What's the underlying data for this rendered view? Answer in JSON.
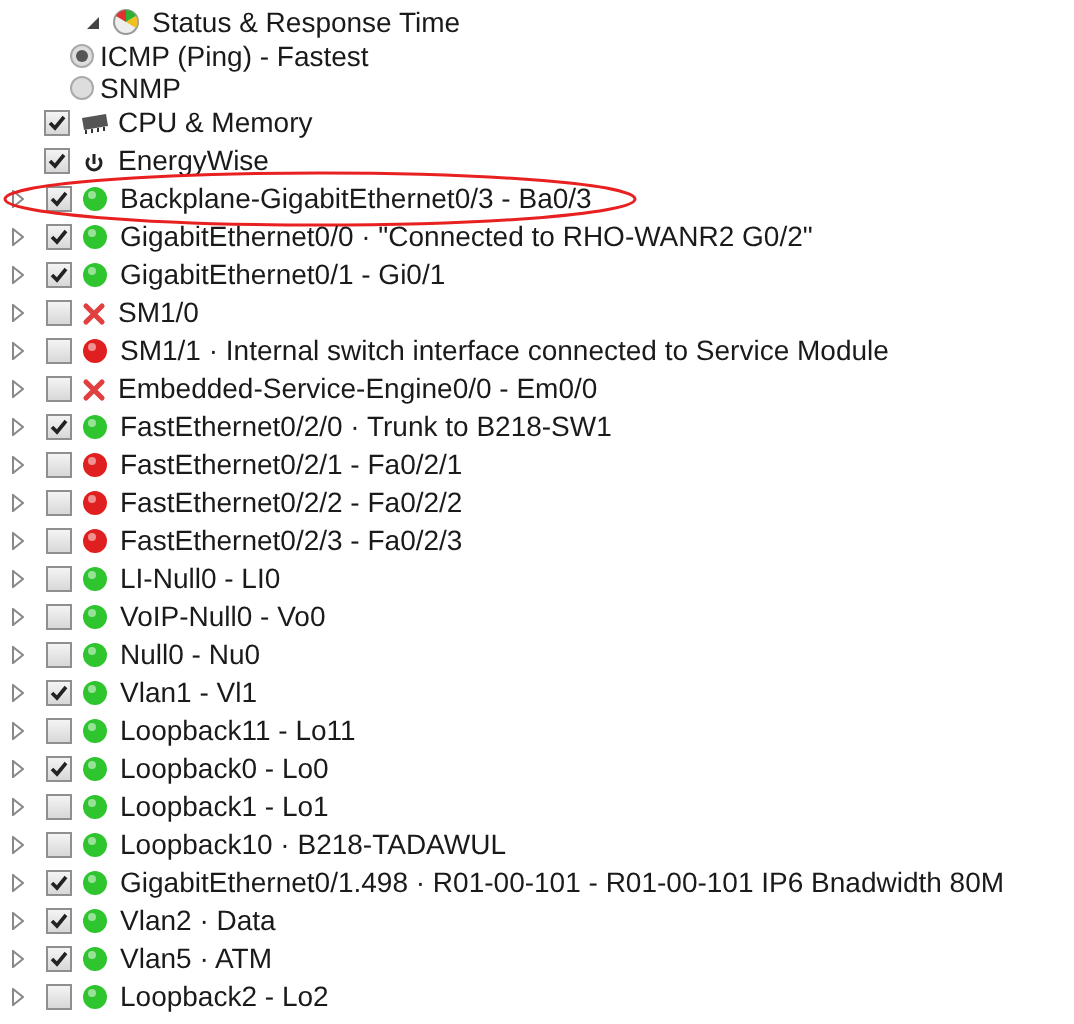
{
  "poller": {
    "label": "Status & Response Time",
    "expanded": true,
    "options": [
      {
        "label": "ICMP (Ping) - Fastest",
        "selected": true
      },
      {
        "label": "SNMP",
        "selected": false
      }
    ]
  },
  "resources": [
    {
      "kind": "chip",
      "label": "CPU & Memory",
      "checked": true
    },
    {
      "kind": "power",
      "label": "EnergyWise",
      "checked": true
    }
  ],
  "interfaces": [
    {
      "label": "Backplane-GigabitEthernet0/3 - Ba0/3",
      "checked": true,
      "kind": "dot",
      "color": "#2fc52f",
      "circled": true
    },
    {
      "label": "GigabitEthernet0/0 · \"Connected to RHO-WANR2 G0/2\"",
      "checked": true,
      "kind": "dot",
      "color": "#2fc52f",
      "circled": false
    },
    {
      "label": "GigabitEthernet0/1 - Gi0/1",
      "checked": true,
      "kind": "dot",
      "color": "#2fc52f",
      "circled": false
    },
    {
      "label": "SM1/0",
      "checked": false,
      "kind": "cross",
      "color": "#e04040",
      "circled": false
    },
    {
      "label": "SM1/1 · Internal switch interface connected to Service Module",
      "checked": false,
      "kind": "dot",
      "color": "#e02020",
      "circled": false
    },
    {
      "label": "Embedded-Service-Engine0/0 - Em0/0",
      "checked": false,
      "kind": "cross",
      "color": "#e04040",
      "circled": false
    },
    {
      "label": "FastEthernet0/2/0 · Trunk to B218-SW1",
      "checked": true,
      "kind": "dot",
      "color": "#2fc52f",
      "circled": false
    },
    {
      "label": "FastEthernet0/2/1 - Fa0/2/1",
      "checked": false,
      "kind": "dot",
      "color": "#e02020",
      "circled": false
    },
    {
      "label": "FastEthernet0/2/2 - Fa0/2/2",
      "checked": false,
      "kind": "dot",
      "color": "#e02020",
      "circled": false
    },
    {
      "label": "FastEthernet0/2/3 - Fa0/2/3",
      "checked": false,
      "kind": "dot",
      "color": "#e02020",
      "circled": false
    },
    {
      "label": "LI-Null0 - LI0",
      "checked": false,
      "kind": "dot",
      "color": "#2fc52f",
      "circled": false
    },
    {
      "label": "VoIP-Null0 - Vo0",
      "checked": false,
      "kind": "dot",
      "color": "#2fc52f",
      "circled": false
    },
    {
      "label": "Null0 - Nu0",
      "checked": false,
      "kind": "dot",
      "color": "#2fc52f",
      "circled": false
    },
    {
      "label": "Vlan1 - Vl1",
      "checked": true,
      "kind": "dot",
      "color": "#2fc52f",
      "circled": false
    },
    {
      "label": "Loopback11 - Lo11",
      "checked": false,
      "kind": "dot",
      "color": "#2fc52f",
      "circled": false
    },
    {
      "label": "Loopback0 - Lo0",
      "checked": true,
      "kind": "dot",
      "color": "#2fc52f",
      "circled": false
    },
    {
      "label": "Loopback1 - Lo1",
      "checked": false,
      "kind": "dot",
      "color": "#2fc52f",
      "circled": false
    },
    {
      "label": "Loopback10 · B218-TADAWUL",
      "checked": false,
      "kind": "dot",
      "color": "#2fc52f",
      "circled": false
    },
    {
      "label": "GigabitEthernet0/1.498 · R01-00-101 - R01-00-101 IP6 Bnadwidth 80M",
      "checked": true,
      "kind": "dot",
      "color": "#2fc52f",
      "circled": false
    },
    {
      "label": "Vlan2 · Data",
      "checked": true,
      "kind": "dot",
      "color": "#2fc52f",
      "circled": false
    },
    {
      "label": "Vlan5 · ATM",
      "checked": true,
      "kind": "dot",
      "color": "#2fc52f",
      "circled": false
    },
    {
      "label": "Loopback2 - Lo2",
      "checked": false,
      "kind": "dot",
      "color": "#2fc52f",
      "circled": false
    }
  ]
}
